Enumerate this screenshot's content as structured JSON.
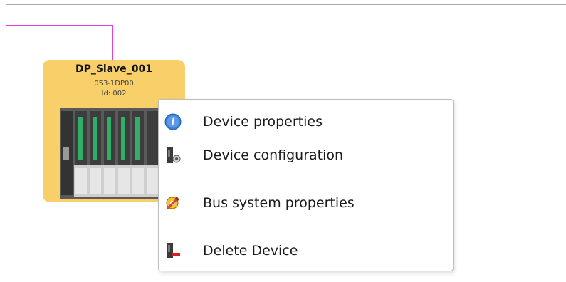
{
  "device": {
    "name": "DP_Slave_001",
    "order_number": "053-1DP00",
    "id_label": "Id: 002"
  },
  "colors": {
    "bus_line": "#e040e0",
    "device_header": "#f9cf6a"
  },
  "context_menu": {
    "items": [
      {
        "label": "Device properties",
        "icon": "info-icon"
      },
      {
        "label": "Device configuration",
        "icon": "device-config-icon"
      },
      {
        "label": "Bus system properties",
        "icon": "bus-system-icon"
      },
      {
        "label": "Delete Device",
        "icon": "delete-device-icon"
      }
    ]
  }
}
